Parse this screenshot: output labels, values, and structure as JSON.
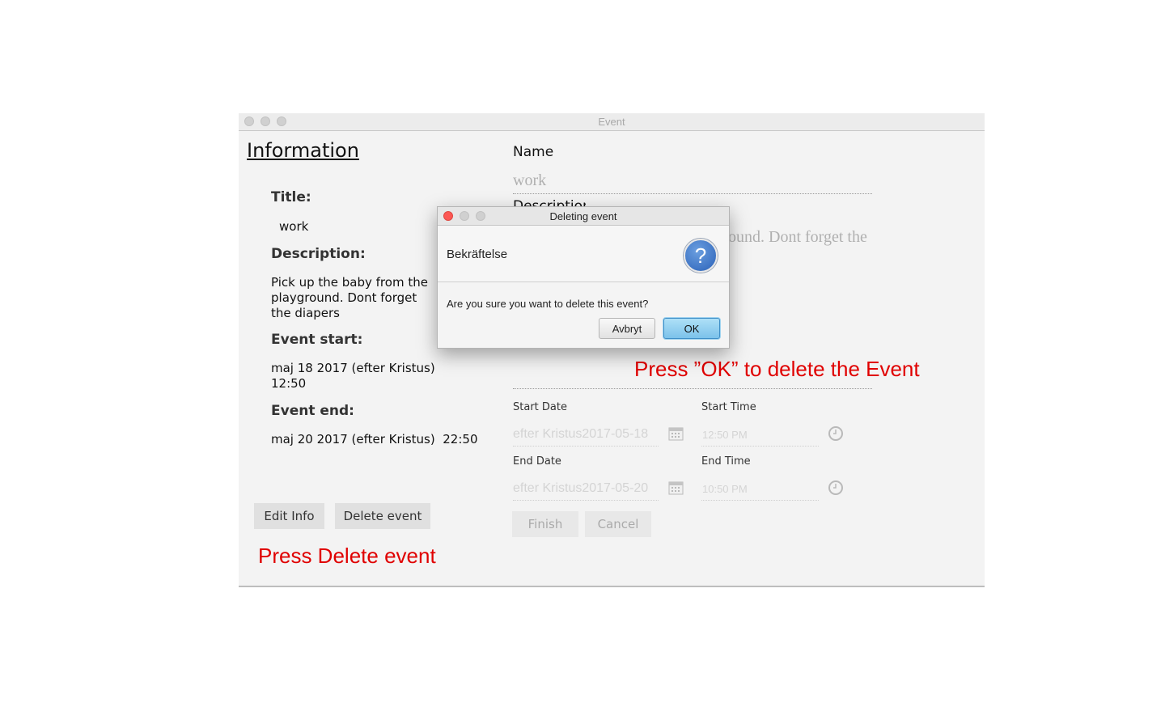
{
  "window": {
    "title": "Event"
  },
  "info": {
    "heading": "Information",
    "title_label": "Title:",
    "title_value": "work",
    "description_label": "Description:",
    "description_value": "Pick up the baby from the playground. Dont forget the diapers",
    "start_label": "Event start:",
    "start_value_line1": "maj 18 2017 (efter Kristus)",
    "start_value_line2": "12:50",
    "end_label": "Event end:",
    "end_value": "maj 20 2017 (efter Kristus)  22:50",
    "edit_button": "Edit Info",
    "delete_button": "Delete event"
  },
  "form": {
    "name_label": "Name",
    "name_value": "work",
    "description_label_partial": "Description",
    "description_value_partial": "ound. Dont forget the",
    "start_date_label": "Start Date",
    "start_date_value": "efter Kristus2017-05-18",
    "start_time_label": "Start Time",
    "start_time_value": "12:50 PM",
    "end_date_label": "End Date",
    "end_date_value": "efter Kristus2017-05-20",
    "end_time_label": "End Time",
    "end_time_value": "10:50 PM",
    "finish_button": "Finish",
    "cancel_button": "Cancel",
    "calendar_icon": "calendar-icon",
    "clock_icon": "clock-icon"
  },
  "dialog": {
    "title": "Deleting event",
    "header": "Bekräftelse",
    "content": "Are you sure you want to delete this event?",
    "cancel_button": "Avbryt",
    "ok_button": "OK",
    "icon": "question-icon",
    "icon_glyph": "?"
  },
  "annotations": {
    "press_ok": "Press ”OK” to delete the Event",
    "press_delete": "Press Delete event",
    "color": "#e00000"
  }
}
